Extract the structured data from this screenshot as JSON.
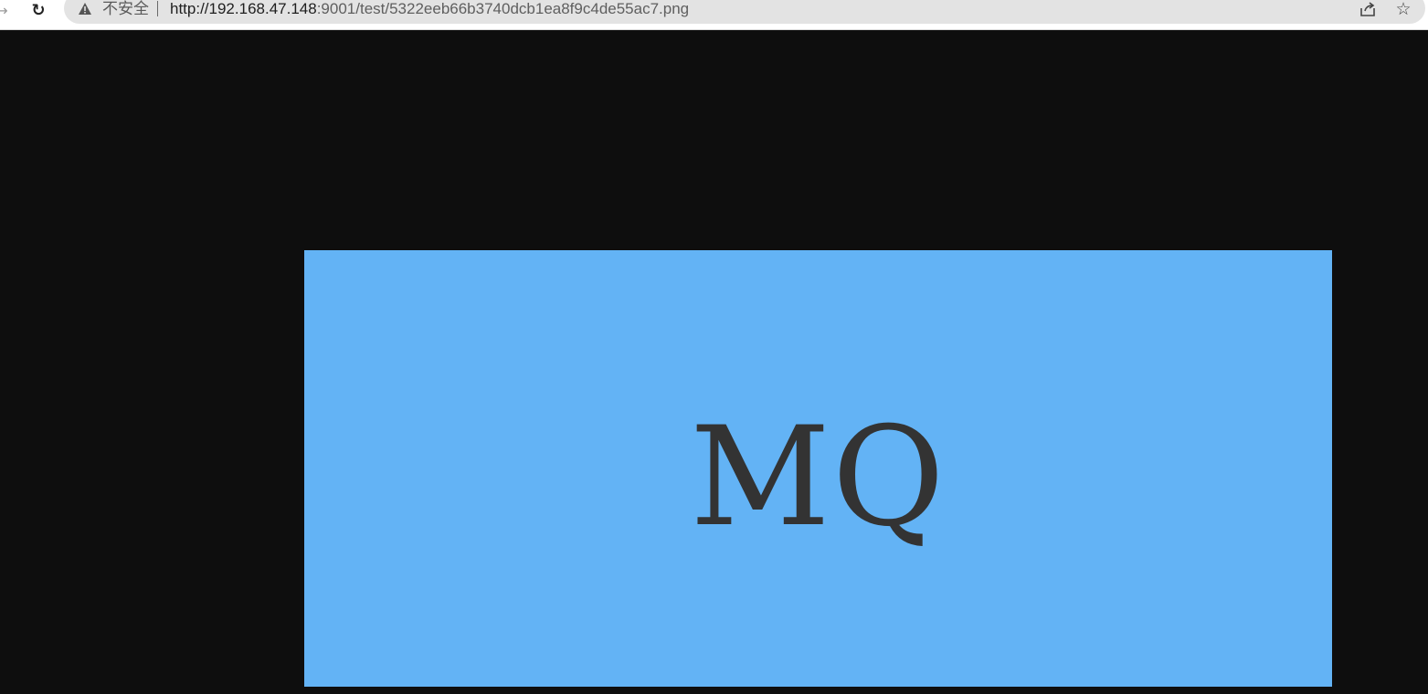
{
  "browser": {
    "security_label": "不安全",
    "url_host": "http://192.168.47.148",
    "url_path": ":9001/test/5322eeb66b3740dcb1ea8f9c4de55ac7.png",
    "icons": {
      "forward": "forward-arrow-icon",
      "reload": "reload-icon",
      "warning": "warning-triangle-icon",
      "share": "share-icon",
      "bookmark": "star-icon"
    }
  },
  "viewer": {
    "image_text": "MQ",
    "background_color": "#0e0e0e",
    "image_color": "#63b3f5",
    "text_color": "#333333"
  }
}
